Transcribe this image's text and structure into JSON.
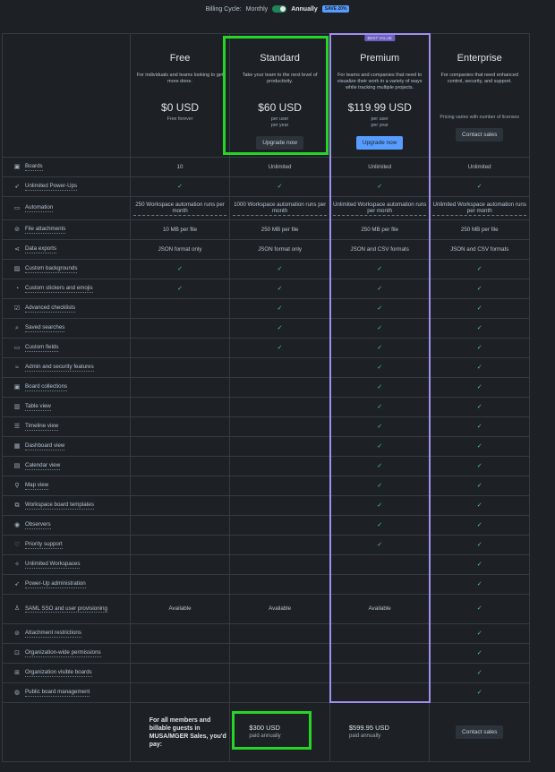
{
  "billing": {
    "label": "Billing Cycle:",
    "monthly": "Monthly",
    "annually": "Annually",
    "save": "SAVE 20%"
  },
  "plans": [
    {
      "name": "Free",
      "desc": "For individuals and teams looking to get more done.",
      "price": "$0 USD",
      "sub1": "Free forever",
      "sub2": "",
      "button": ""
    },
    {
      "name": "Standard",
      "desc": "Take your team to the next level of productivity.",
      "price": "$60 USD",
      "sub1": "per user",
      "sub2": "per year",
      "button": "Upgrade now"
    },
    {
      "name": "Premium",
      "desc": "For teams and companies that need to visualize their work in a variety of ways while tracking multiple projects.",
      "price": "$119.99 USD",
      "sub1": "per user",
      "sub2": "per year",
      "button": "Upgrade now",
      "badge": "BEST VALUE"
    },
    {
      "name": "Enterprise",
      "desc": "For companies that need enhanced control, security, and support.",
      "price": "",
      "sub1": "Pricing varies with number of licenses",
      "sub2": "",
      "button": "Contact sales"
    }
  ],
  "features": [
    {
      "name": "Boards",
      "icon": "board-icon",
      "glyph": "▣",
      "v": [
        "10",
        "Unlimited",
        "Unlimited",
        "Unlimited"
      ]
    },
    {
      "name": "Unlimited Power-Ups",
      "icon": "rocket-icon",
      "glyph": "➶",
      "v": [
        "check",
        "check",
        "check",
        "check"
      ]
    },
    {
      "name": "Automation",
      "icon": "automation-icon",
      "glyph": "▭",
      "v": [
        "250 Workspace automation runs per month",
        "1000 Workspace automation runs per month",
        "Unlimited Workspace automation runs per month",
        "Unlimited Workspace automation runs per month"
      ],
      "tall": true
    },
    {
      "name": "File attachments",
      "icon": "attachment-icon",
      "glyph": "⊘",
      "v": [
        "10 MB per file",
        "250 MB per file",
        "250 MB per file",
        "250 MB per file"
      ]
    },
    {
      "name": "Data exports",
      "icon": "share-icon",
      "glyph": "⋖",
      "v": [
        "JSON format only",
        "JSON format only",
        "JSON and CSV formats",
        "JSON and CSV formats"
      ]
    },
    {
      "name": "Custom backgrounds",
      "icon": "image-icon",
      "glyph": "▨",
      "v": [
        "check",
        "check",
        "check",
        "check"
      ]
    },
    {
      "name": "Custom stickers and emojis",
      "icon": "sticker-icon",
      "glyph": "◔",
      "v": [
        "check",
        "check",
        "check",
        "check"
      ]
    },
    {
      "name": "Advanced checklists",
      "icon": "checklist-icon",
      "glyph": "☑",
      "v": [
        "",
        "check",
        "check",
        "check"
      ]
    },
    {
      "name": "Saved searches",
      "icon": "search-icon",
      "glyph": "⌕",
      "v": [
        "",
        "check",
        "check",
        "check"
      ]
    },
    {
      "name": "Custom fields",
      "icon": "field-icon",
      "glyph": "▭",
      "v": [
        "",
        "check",
        "check",
        "check"
      ]
    },
    {
      "name": "Admin and security features",
      "icon": "shield-icon",
      "glyph": "≈",
      "v": [
        "",
        "",
        "check",
        "check"
      ]
    },
    {
      "name": "Board collections",
      "icon": "collection-icon",
      "glyph": "▣",
      "v": [
        "",
        "",
        "check",
        "check"
      ]
    },
    {
      "name": "Table view",
      "icon": "table-icon",
      "glyph": "▥",
      "v": [
        "",
        "",
        "check",
        "check"
      ]
    },
    {
      "name": "Timeline view",
      "icon": "timeline-icon",
      "glyph": "☰",
      "v": [
        "",
        "",
        "check",
        "check"
      ]
    },
    {
      "name": "Dashboard view",
      "icon": "dashboard-icon",
      "glyph": "▦",
      "v": [
        "",
        "",
        "check",
        "check"
      ]
    },
    {
      "name": "Calendar view",
      "icon": "calendar-icon",
      "glyph": "▤",
      "v": [
        "",
        "",
        "check",
        "check"
      ]
    },
    {
      "name": "Map view",
      "icon": "map-pin-icon",
      "glyph": "⚲",
      "v": [
        "",
        "",
        "check",
        "check"
      ]
    },
    {
      "name": "Workspace board templates",
      "icon": "template-icon",
      "glyph": "⧉",
      "v": [
        "",
        "",
        "check",
        "check"
      ]
    },
    {
      "name": "Observers",
      "icon": "eye-icon",
      "glyph": "◉",
      "v": [
        "",
        "",
        "check",
        "check"
      ]
    },
    {
      "name": "Priority support",
      "icon": "heart-icon",
      "glyph": "♡",
      "v": [
        "",
        "",
        "check",
        "check"
      ]
    },
    {
      "name": "Unlimited Workspaces",
      "icon": "sparkle-icon",
      "glyph": "✧",
      "v": [
        "",
        "",
        "",
        "check"
      ]
    },
    {
      "name": "Power-Up administration",
      "icon": "rocket-icon",
      "glyph": "➶",
      "v": [
        "",
        "",
        "",
        "check"
      ]
    },
    {
      "name": "SAML SSO and user provisioning",
      "icon": "user-icon",
      "glyph": "♙",
      "v": [
        "Available",
        "Available",
        "Available",
        "check"
      ],
      "tall2": true
    },
    {
      "name": "Attachment restrictions",
      "icon": "attachment-icon",
      "glyph": "⊘",
      "v": [
        "",
        "",
        "",
        "check"
      ]
    },
    {
      "name": "Organization-wide permissions",
      "icon": "lock-icon",
      "glyph": "⊡",
      "v": [
        "",
        "",
        "",
        "check"
      ]
    },
    {
      "name": "Organization visible boards",
      "icon": "org-icon",
      "glyph": "⊞",
      "v": [
        "",
        "",
        "",
        "check"
      ]
    },
    {
      "name": "Public board management",
      "icon": "globe-icon",
      "glyph": "◍",
      "v": [
        "",
        "",
        "",
        "check"
      ]
    }
  ],
  "footer": {
    "text": "For all members and billable guests in MUSA/MGER Sales, you'd pay:",
    "standard_price": "$300 USD",
    "standard_sub": "paid annually",
    "premium_price": "$599.95 USD",
    "premium_sub": "paid annually",
    "enterprise_button": "Contact sales"
  },
  "colors": {
    "accent": "#579dff",
    "check": "#4bce97",
    "highlight": "#26d626",
    "premium_border": "#9f8fef"
  }
}
